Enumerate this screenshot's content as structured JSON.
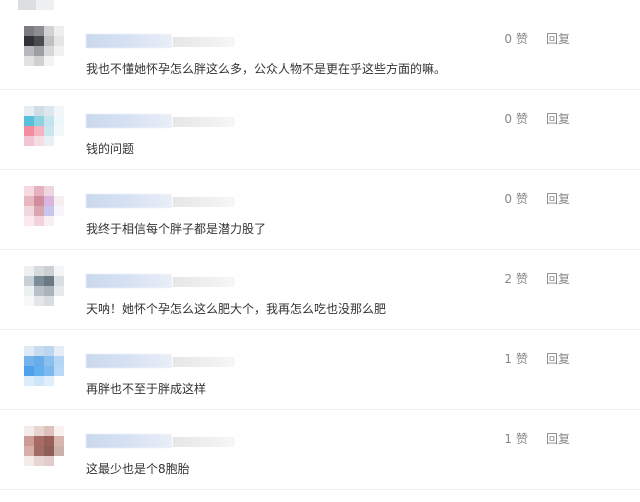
{
  "colors": {
    "text": "#333333",
    "muted": "#888888",
    "divider": "#f0f0f0",
    "name_blur": "#cfdcf1",
    "meta_blur": "#ececec"
  },
  "comments": [
    {
      "text": "我也不懂她怀孕怎么胖这么多，公众人物不是更在乎这些方面的嘛。",
      "likes": "0",
      "like_label": "赞",
      "reply_label": "回复",
      "avatar_colors": [
        "#7b7c80",
        "#8c8d90",
        "#d2d2d4",
        "#eeeeef",
        "#303236",
        "#4a4b4f",
        "#bfc0c3",
        "#e5e5e6",
        "#b7b8bb",
        "#9d9ea1",
        "#d8d8d9",
        "#f1f1f2",
        "#e2e2e3",
        "#cfd0d2",
        "#f4f4f5",
        "#ffffff"
      ]
    },
    {
      "text": "钱的问题",
      "likes": "0",
      "like_label": "赞",
      "reply_label": "回复",
      "avatar_colors": [
        "#e7edf3",
        "#cfdde8",
        "#dce7ee",
        "#f2f6f8",
        "#59c0d9",
        "#8cd2e0",
        "#c4e4ed",
        "#eef7fa",
        "#f28ea0",
        "#f6b3c0",
        "#cde6ee",
        "#f3f8fa",
        "#f1c5d1",
        "#f7dce3",
        "#e7f1f5",
        "#ffffff"
      ]
    },
    {
      "text": "我终于相信每个胖子都是潜力股了",
      "likes": "0",
      "like_label": "赞",
      "reply_label": "回复",
      "avatar_colors": [
        "#f6d9e1",
        "#e7b2bf",
        "#efd5df",
        "#ffffff",
        "#e7b8c2",
        "#cf8d9d",
        "#d9b4df",
        "#f8edf1",
        "#f1d8de",
        "#d9a5b0",
        "#c8c6ec",
        "#f7f5fb",
        "#fce9ef",
        "#f3d2dc",
        "#f8eef3",
        "#ffffff"
      ]
    },
    {
      "text": "天呐！她怀个孕怎么这么肥大个，我再怎么吃也没那么肥",
      "likes": "2",
      "like_label": "赞",
      "reply_label": "回复",
      "avatar_colors": [
        "#eef0f1",
        "#d6dbde",
        "#cbd0d4",
        "#f4f5f6",
        "#c7d0d7",
        "#7b8d98",
        "#687983",
        "#d9dee2",
        "#eef1f2",
        "#b8c1c7",
        "#aab3ba",
        "#e6e9eb",
        "#f7f8f9",
        "#e4e7e9",
        "#d8dde0",
        "#ffffff"
      ]
    },
    {
      "text": "再胖也不至于胖成这样",
      "likes": "1",
      "like_label": "赞",
      "reply_label": "回复",
      "avatar_colors": [
        "#dfeaf4",
        "#c8dbef",
        "#bdd5ee",
        "#e5eef7",
        "#74b4ea",
        "#68acea",
        "#8bc0ee",
        "#b5d6f4",
        "#4da1eb",
        "#64aff0",
        "#7db9f0",
        "#b7d8f6",
        "#dcecfa",
        "#cfe5f8",
        "#dfeefa",
        "#ffffff"
      ]
    },
    {
      "text": "这最少也是个8胞胎",
      "likes": "1",
      "like_label": "赞",
      "reply_label": "回复",
      "avatar_colors": [
        "#f4ecea",
        "#e8d5d1",
        "#dec1bb",
        "#f8f1ef",
        "#cc9b94",
        "#a96c65",
        "#986058",
        "#d8b6b0",
        "#d8aea8",
        "#a16c66",
        "#8f5d58",
        "#ceb0aa",
        "#f5ebe9",
        "#e6d5d2",
        "#e1cdca",
        "#ffffff"
      ]
    }
  ]
}
